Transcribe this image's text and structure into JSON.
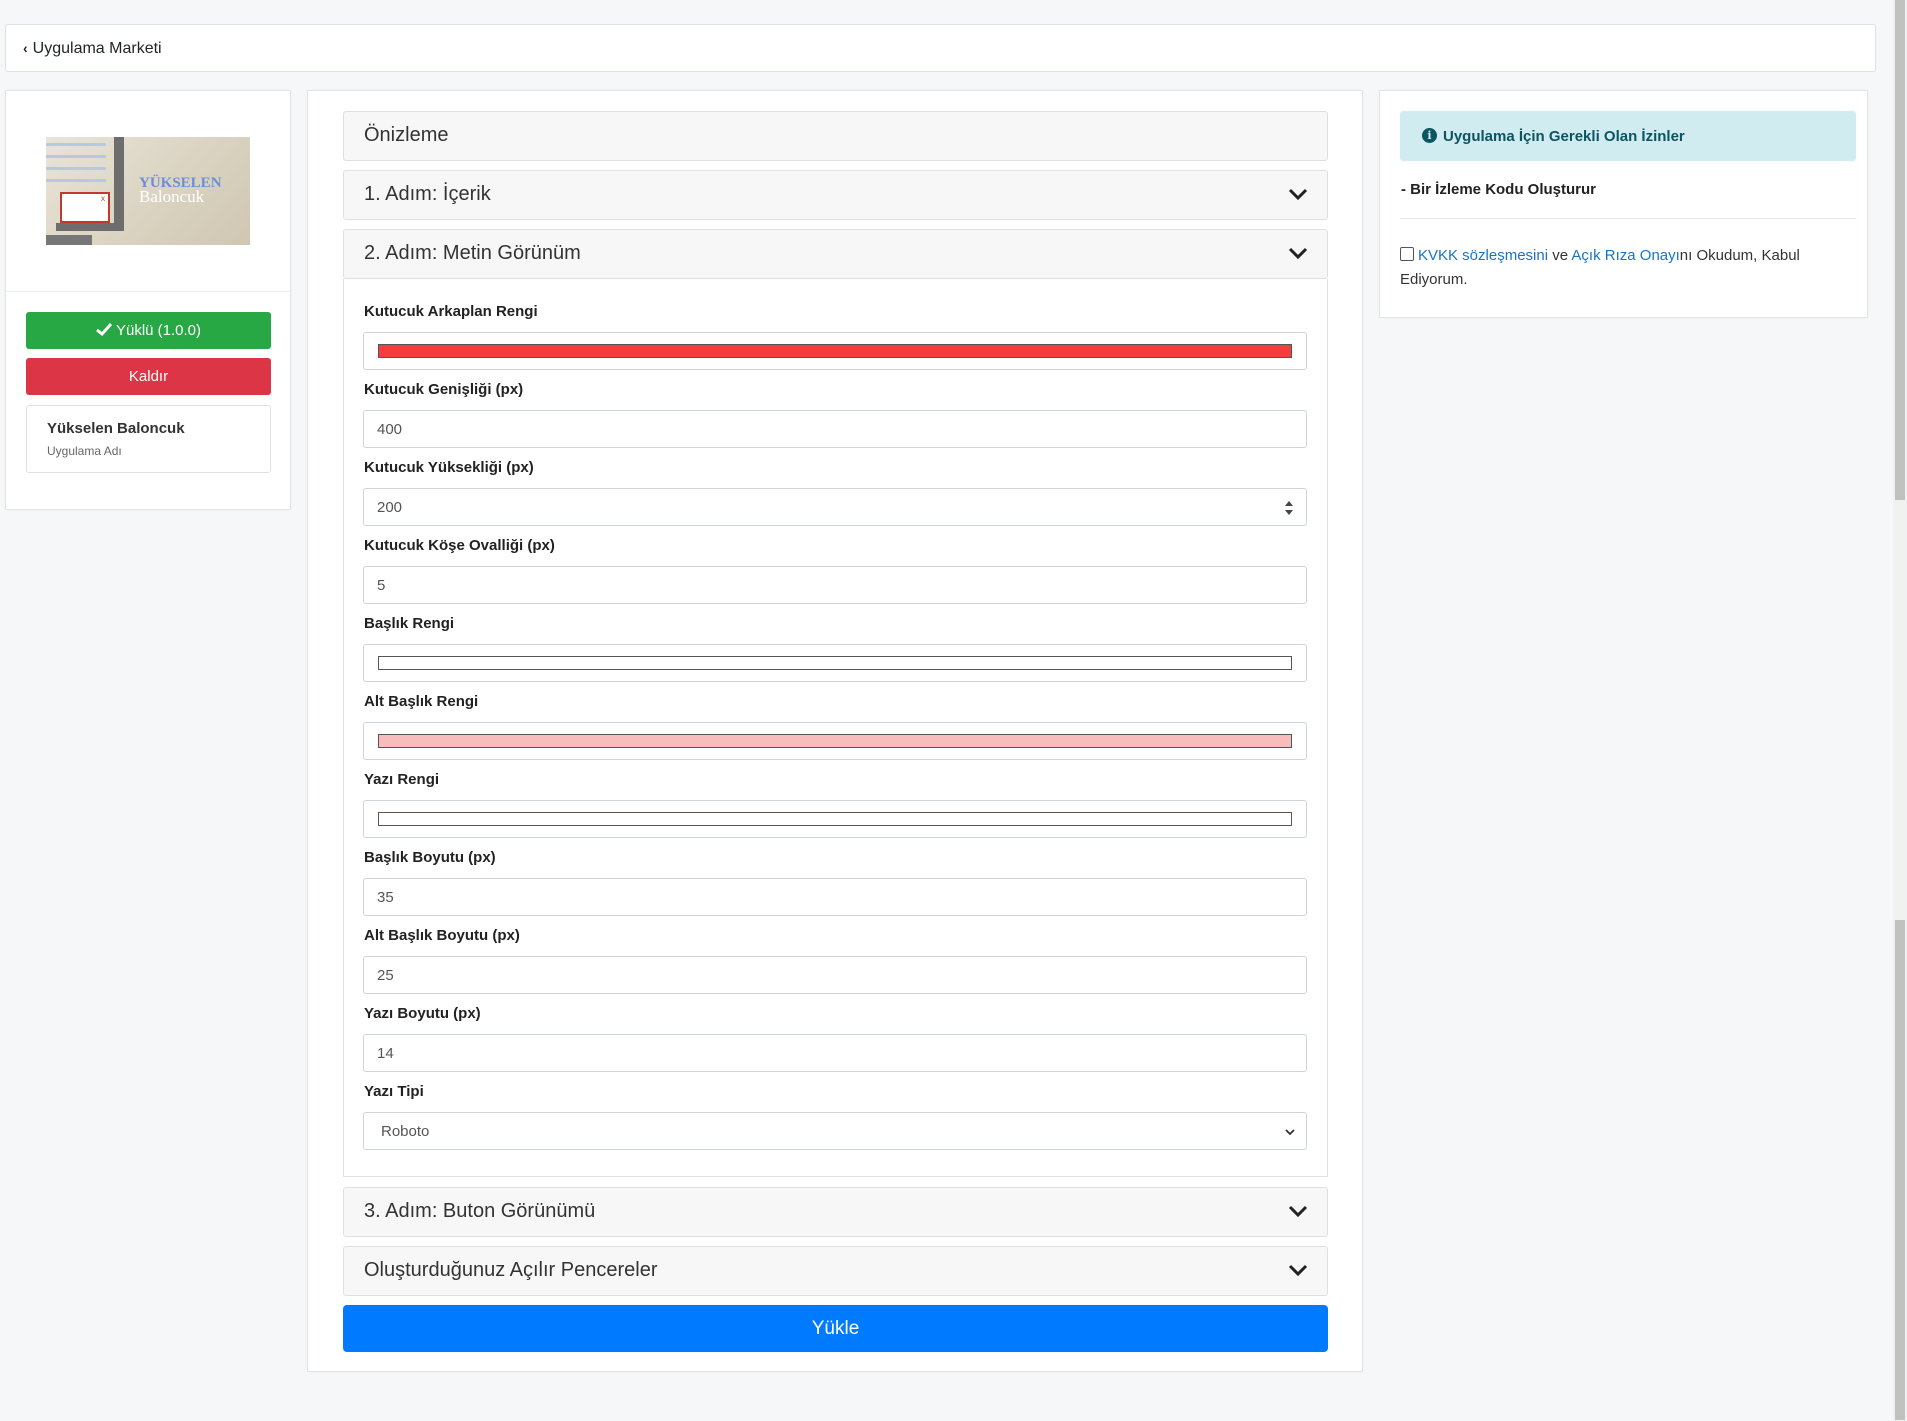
{
  "topbar": {
    "back_label": "Uygulama Marketi"
  },
  "app": {
    "thumb_title_1": "YÜKSELEN",
    "thumb_title_2": "Baloncuk",
    "installed_label": "Yüklü (1.0.0)",
    "remove_label": "Kaldır",
    "name": "Yükselen Baloncuk",
    "name_caption": "Uygulama Adı"
  },
  "accordion": {
    "preview": "Önizleme",
    "step1": "1. Adım: İçerik",
    "step2": "2. Adım: Metin Görünüm",
    "step3": "3. Adım: Buton Görünümü",
    "popups": "Oluşturduğunuz Açılır Pencereler"
  },
  "form": {
    "box_bg_color": {
      "label": "Kutucuk Arkaplan Rengi",
      "color": "#f53d3d"
    },
    "box_width": {
      "label": "Kutucuk Genişliği (px)",
      "value": "400"
    },
    "box_height": {
      "label": "Kutucuk Yüksekliği (px)",
      "value": "200"
    },
    "box_radius": {
      "label": "Kutucuk Köşe Ovalliği (px)",
      "value": "5"
    },
    "title_color": {
      "label": "Başlık Rengi",
      "color": "#ffffff"
    },
    "subtitle_color": {
      "label": "Alt Başlık Rengi",
      "color": "#f9bcbc"
    },
    "text_color": {
      "label": "Yazı Rengi",
      "color": "#ffffff"
    },
    "title_size": {
      "label": "Başlık Boyutu (px)",
      "value": "35"
    },
    "subtitle_size": {
      "label": "Alt Başlık Boyutu (px)",
      "value": "25"
    },
    "text_size": {
      "label": "Yazı Boyutu (px)",
      "value": "14"
    },
    "font": {
      "label": "Yazı Tipi",
      "value": "Roboto"
    }
  },
  "upload_label": "Yükle",
  "permissions": {
    "title": "Uygulama İçin Gerekli Olan İzinler",
    "info_icon": "i",
    "items": [
      "- Bir İzleme Kodu Oluşturur"
    ],
    "consent_link1": "KVKK sözleşmesini",
    "consent_mid": " ve ",
    "consent_link2": "Açık Rıza Onayı",
    "consent_tail": "nı Okudum, Kabul Ediyorum."
  },
  "colors": {
    "primary": "#007bff",
    "success": "#28a745",
    "danger": "#dc3545",
    "info_bg": "#d1ecf1"
  }
}
